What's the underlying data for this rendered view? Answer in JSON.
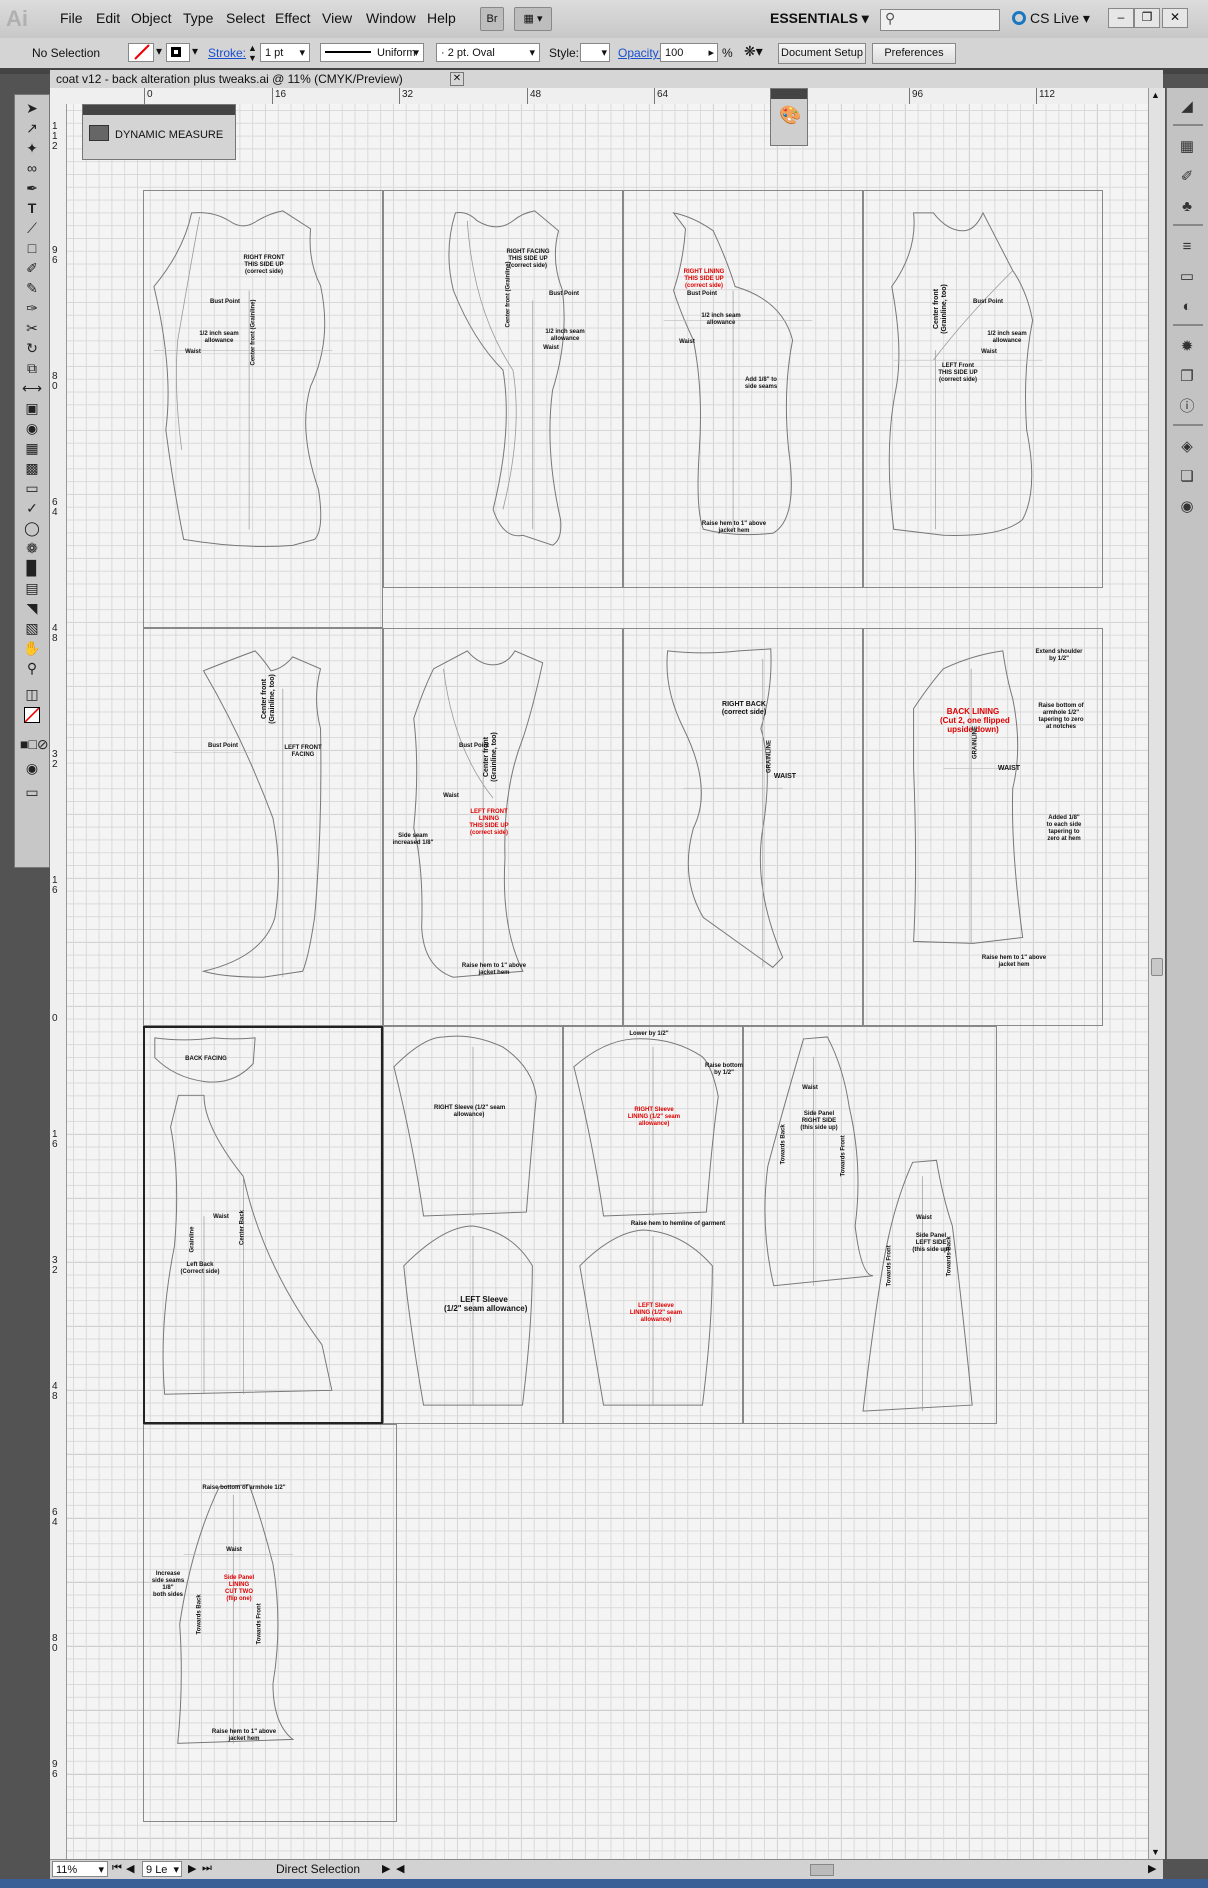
{
  "menubar": {
    "logo": "Ai",
    "menus": [
      "File",
      "Edit",
      "Object",
      "Type",
      "Select",
      "Effect",
      "View",
      "Window",
      "Help"
    ],
    "bridge_label": "Br",
    "workspace": "ESSENTIALS",
    "cs_live": "CS Live"
  },
  "control_bar": {
    "selection": "No Selection",
    "stroke_label": "Stroke:",
    "stroke_weight": "1 pt",
    "stroke_profile": "Uniform",
    "brush": "2 pt. Oval",
    "style_label": "Style:",
    "opacity_label": "Opacity:",
    "opacity_value": "100",
    "opacity_unit": "%",
    "document_setup": "Document Setup",
    "preferences": "Preferences"
  },
  "document": {
    "title": "coat v12 - back alteration plus tweaks.ai @ 11% (CMYK/Preview)",
    "ruler_h": [
      "0",
      "16",
      "32",
      "48",
      "64",
      "80",
      "96",
      "112"
    ],
    "ruler_v": [
      "1\n1\n2",
      "9\n6",
      "8\n0",
      "6\n4",
      "4\n8",
      "3\n2",
      "1\n6",
      "0",
      "1\n6",
      "3\n2",
      "4\n8",
      "6\n4",
      "8\n0",
      "9\n6"
    ]
  },
  "panels": {
    "dynamic_measure": "DYNAMIC MEASURE"
  },
  "pages": {
    "p1": [
      "RIGHT FRONT\nTHIS SIDE UP\n(correct side)",
      "Bust Point",
      "1/2 inch seam\nallowance",
      "Waist",
      "Center front (Grainline)"
    ],
    "p2": [
      "RIGHT FACING\nTHIS SIDE UP\n(correct side)",
      "Bust Point",
      "Center front (Grainline)",
      "1/2 inch seam\nallowance",
      "Waist"
    ],
    "p3": [
      "RIGHT LINING\nTHIS SIDE UP\n(correct side)",
      "Bust Point",
      "1/2 inch seam\nallowance",
      "Waist",
      "Add 1/8\" to\nside seams",
      "Raise hem to 1\" above\njacket hem"
    ],
    "p4": [
      "Bust Point",
      "Center front\n(Grainline, too)",
      "1/2 inch seam\nallowance",
      "Waist",
      "LEFT Front\nTHIS SIDE UP\n(correct side)"
    ],
    "p5": [
      "Center front\n(Grainline, too)",
      "Bust Point",
      "LEFT FRONT\nFACING"
    ],
    "p6": [
      "Bust Point",
      "Center front\n(Grainline, too)",
      "Waist",
      "LEFT FRONT\nLINING\nTHIS SIDE UP\n(correct side)",
      "Side seam\nincreased 1/8\"",
      "Raise hem to 1\" above\njacket hem"
    ],
    "p7": [
      "RIGHT BACK\n(correct side)",
      "GRAINLINE",
      "WAIST"
    ],
    "p8": [
      "Extend shoulder\nby 1/2\"",
      "BACK LINING\n(Cut 2, one flipped\nupside down)",
      "Raise bottom of\narmhole 1/2\"\ntapering to zero\nat notches",
      "GRAINLINE",
      "WAIST",
      "Added 1/8\"\nto each side\ntapering to\nzero at hem",
      "Raise hem to 1\" above\njacket hem"
    ],
    "p9": [
      "BACK FACING",
      "Waist",
      "Grainline",
      "Center Back",
      "Left Back\n(Correct side)"
    ],
    "p10": [
      "RIGHT Sleeve (1/2\" seam\nallowance)",
      "LEFT Sleeve\n(1/2\" seam allowance)"
    ],
    "p11": [
      "Lower by 1/2\"",
      "Raise bottom\nby 1/2\"",
      "RIGHT Sleeve\nLINING (1/2\" seam\nallowance)",
      "Raise hem to hemline of garment",
      "LEFT Sleeve\nLINING (1/2\" seam\nallowance)"
    ],
    "p12": [
      "Waist",
      "Side Panel\nRIGHT SIDE\n(this side up)",
      "Towards Back",
      "Towards Front",
      "Waist",
      "Side Panel\nLEFT SIDE\n(this side up)",
      "Towards Front",
      "Towards Back"
    ],
    "p13": [
      "Raise bottom of armhole 1/2\"",
      "Waist",
      "Increase\nside seams\n1/8\"\nboth sides",
      "Side Panel\nLINING\nCUT TWO\n(flip one)",
      "Towards Back",
      "Towards Front",
      "Raise hem to 1\" above\njacket hem"
    ]
  },
  "status": {
    "zoom": "11%",
    "page": "9",
    "page_suffix": "Le",
    "tool": "Direct Selection"
  },
  "colors": {
    "accent_red": "#e00000",
    "link_blue": "#1a4fd0",
    "cs_live_blue": "#1a78c2"
  }
}
